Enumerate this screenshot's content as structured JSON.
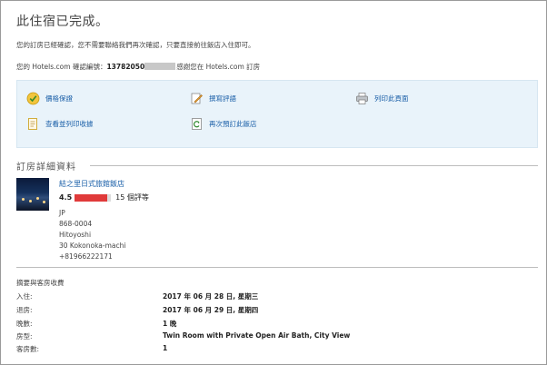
{
  "page": {
    "title": "此住宿已完成。",
    "line1": "您的訂房已經確認，您不需要聯絡我們再次確認，只要直接前往飯店入住即可。",
    "line2_prefix": "您的 Hotels.com 確認編號：",
    "confirmation_visible": "13782050",
    "line2_suffix": "感謝您在 Hotels.com 訂房"
  },
  "actions": {
    "price_guarantee": "價格保證",
    "write_review": "撰寫評語",
    "print_page": "列印此頁面",
    "view_receipt": "查看並列印收據",
    "rebook": "再次預訂此飯店"
  },
  "booking": {
    "section_title": "訂房詳細資料",
    "hotel_name": "結之里日式旅館飯店",
    "rating_score": "4.5",
    "rating_fraction": 0.9,
    "reviews": "15 個評等",
    "address": [
      "JP",
      "868-0004",
      "Hitoyoshi",
      "30 Kokonoka-machi",
      "+81966222171"
    ]
  },
  "summary": {
    "heading": "摘要與客房收費",
    "rows": [
      {
        "label": "入住:",
        "value": "2017 年 06 月 28 日, 星期三"
      },
      {
        "label": "退房:",
        "value": "2017 年 06 月 29 日, 星期四"
      },
      {
        "label": "晚數:",
        "value": "1 晚"
      },
      {
        "label": "房型:",
        "value": "Twin Room with Private Open Air Bath, City View"
      },
      {
        "label": "客房數:",
        "value": "1"
      }
    ]
  },
  "colors": {
    "link": "#1a5fa8",
    "action_bg": "#e9f3fa",
    "star": "#e03a3a"
  }
}
